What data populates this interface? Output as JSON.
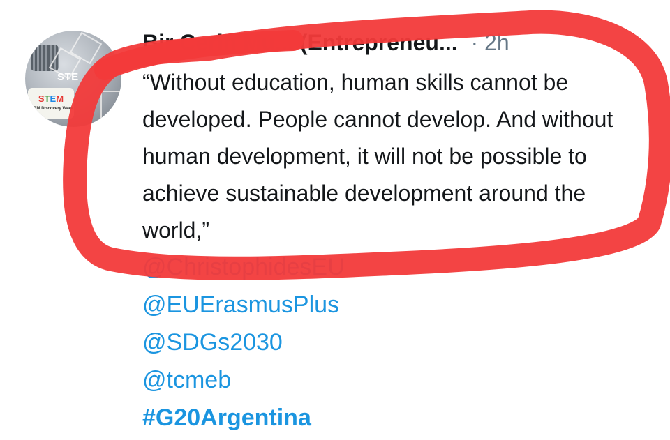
{
  "tweet": {
    "author_display": "Bir Cerin Mu... (Entrepreneu...",
    "timestamp": "· 2h",
    "text": "“Without education, human skills cannot be developed. People cannot develop. And without human development, it will not be possible to achieve sustainable development around the world,”",
    "mentions": [
      "@ChristophidesEU",
      "@EUErasmusPlus",
      "@SDGs2030",
      "@tcmeb"
    ],
    "hashtag": "#G20Argentina"
  },
  "avatar": {
    "text": "STE",
    "badge": "STEM Discovery Week"
  },
  "annotation": {
    "color": "#f23a3a",
    "shape": "hand-drawn-ellipse-around-quote"
  },
  "colors": {
    "link": "#1b95e0",
    "text": "#14171a",
    "muted": "#657786"
  }
}
